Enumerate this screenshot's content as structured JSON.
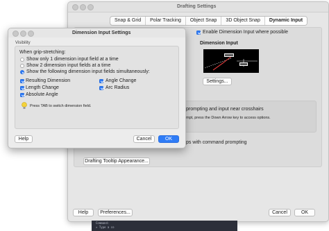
{
  "drafting": {
    "title": "Drafting Settings",
    "tabs": [
      "Snap & Grid",
      "Polar Tracking",
      "Object Snap",
      "3D Object Snap",
      "Dynamic Input"
    ],
    "active_tab": "Dynamic Input",
    "enable_dynamic_input": {
      "label": "Enable Dimension Input where possible",
      "checked": true
    },
    "dimension_input_title": "Dimension Input",
    "settings_button": "Settings...",
    "prompt_text_1": "prompting and input near crosshairs",
    "prompt_text_2": "mpt, press the Down Arrow key to access options.",
    "command_prompt_text": "ps with command prompting",
    "tooltip_button": "Drafting Tooltip Appearance...",
    "help_button": "Help",
    "preferences_button": "Preferences...",
    "cancel_button": "Cancel",
    "ok_button": "OK",
    "preview_colors": {
      "background": "#000000",
      "line": "#d93a3a",
      "dim_text": "#ffffff"
    }
  },
  "terminal": {
    "line1": "Command:",
    "line2": "» Type a co"
  },
  "dialog": {
    "title": "Dimension Input Settings",
    "group_label": "Visibility",
    "heading": "When grip-stretching:",
    "radios": [
      {
        "label": "Show only 1 dimension input field at a time",
        "selected": false
      },
      {
        "label": "Show 2 dimension input fields at a time",
        "selected": false
      },
      {
        "label": "Show the following dimension input fields simultaneously:",
        "selected": true
      }
    ],
    "checkboxes_left": [
      {
        "label": "Resulting Dimension",
        "checked": true
      },
      {
        "label": "Length Change",
        "checked": true
      },
      {
        "label": "Absolute Angle",
        "checked": true
      }
    ],
    "checkboxes_right": [
      {
        "label": "Angle Change",
        "checked": true
      },
      {
        "label": "Arc Radius",
        "checked": true
      }
    ],
    "tip_text": "Press TAB to switch dimension field.",
    "help_button": "Help",
    "cancel_button": "Cancel",
    "ok_button": "OK",
    "accent_color": "#2f7cf6"
  }
}
